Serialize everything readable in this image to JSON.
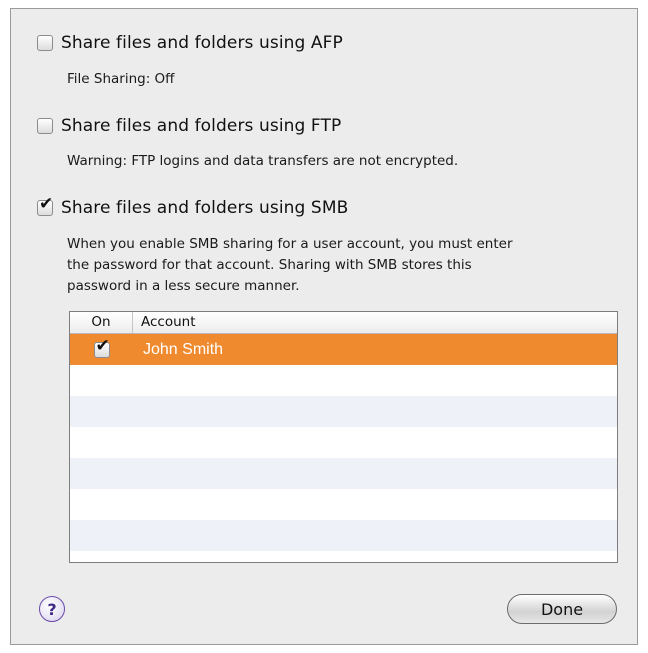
{
  "options": [
    {
      "label": "Share files and folders using AFP",
      "checked": false,
      "description": "File Sharing: Off"
    },
    {
      "label": "Share files and folders using FTP",
      "checked": false,
      "description": "Warning: FTP logins and data transfers are not encrypted."
    },
    {
      "label": "Share files and folders using SMB",
      "checked": true,
      "description_lines": [
        "When you enable SMB sharing for a user account, you must enter",
        "the password for that account. Sharing with SMB stores this",
        "password in a less secure manner."
      ]
    }
  ],
  "accounts_table": {
    "columns": [
      "On",
      "Account"
    ],
    "rows": [
      {
        "on": true,
        "account": "John Smith",
        "selected": true
      }
    ],
    "selection_color": "#ef8a2f"
  },
  "checkmark_glyph": "✔",
  "help_button": {
    "label": "?",
    "icon": "help-icon"
  },
  "done_button": {
    "label": "Done"
  }
}
